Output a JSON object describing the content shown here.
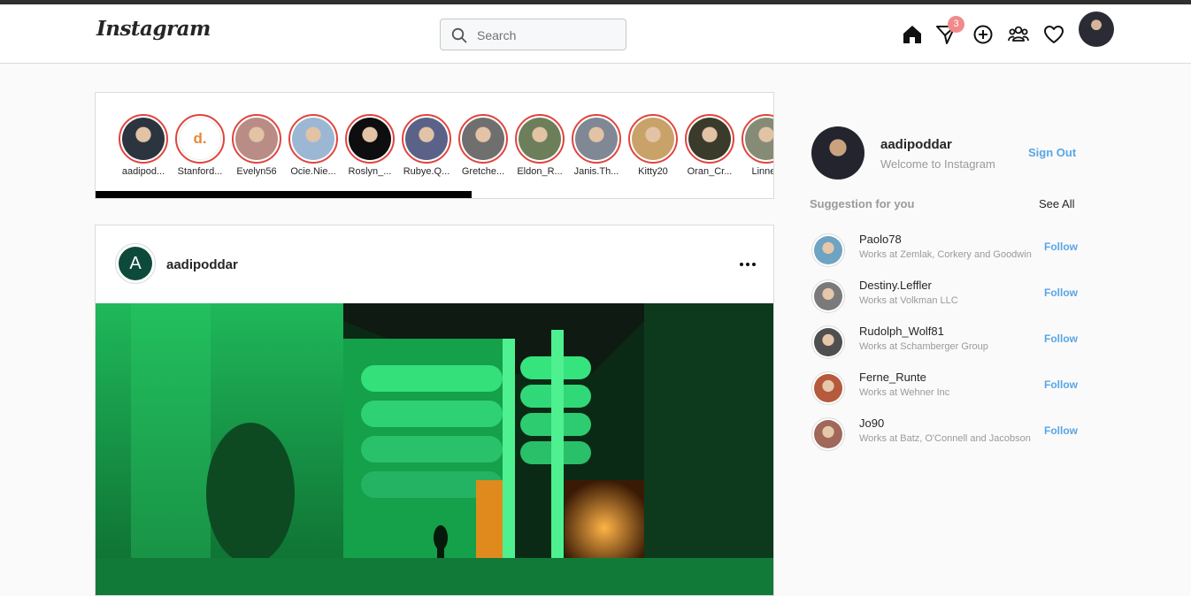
{
  "app": {
    "logo": "Instagram"
  },
  "search": {
    "placeholder": "Search"
  },
  "nav": {
    "icons": [
      "home-icon",
      "direct-message-icon",
      "new-post-icon",
      "people-icon",
      "heart-icon"
    ],
    "message_badge": "3"
  },
  "stories": [
    {
      "username": "aadipod...",
      "color": "#2c3440"
    },
    {
      "username": "Stanford...",
      "color": "#ffffff"
    },
    {
      "username": "Evelyn56",
      "color": "#b98d86"
    },
    {
      "username": "Ocie.Nie...",
      "color": "#9bb7d4"
    },
    {
      "username": "Roslyn_...",
      "color": "#0e0e10"
    },
    {
      "username": "Rubye.Q...",
      "color": "#5a6288"
    },
    {
      "username": "Gretche...",
      "color": "#6f6f6f"
    },
    {
      "username": "Eldon_R...",
      "color": "#6c7f5a"
    },
    {
      "username": "Janis.Th...",
      "color": "#7f8894"
    },
    {
      "username": "Kitty20",
      "color": "#c9a26a"
    },
    {
      "username": "Oran_Cr...",
      "color": "#3b3b2c"
    },
    {
      "username": "Linnea",
      "color": "#868b76"
    }
  ],
  "story_logo_letter": "d.",
  "post": {
    "avatar_letter": "A",
    "username": "aadipoddar",
    "more_icon": "more-icon"
  },
  "profile": {
    "username": "aadipoddar",
    "subtitle": "Welcome to Instagram",
    "sign_out": "Sign Out"
  },
  "suggestions": {
    "title": "Suggestion for you",
    "see_all": "See All",
    "follow_label": "Follow",
    "items": [
      {
        "name": "Paolo78",
        "work": "Works at Zemlak, Corkery and Goodwin",
        "color": "#6fa3c2"
      },
      {
        "name": "Destiny.Leffler",
        "work": "Works at Volkman LLC",
        "color": "#7a7a7a"
      },
      {
        "name": "Rudolph_Wolf81",
        "work": "Works at Schamberger Group",
        "color": "#4f4f4f"
      },
      {
        "name": "Ferne_Runte",
        "work": "Works at Wehner Inc",
        "color": "#b55a3c"
      },
      {
        "name": "Jo90",
        "work": "Works at Batz, O'Connell and Jacobson",
        "color": "#a0685a"
      }
    ]
  }
}
